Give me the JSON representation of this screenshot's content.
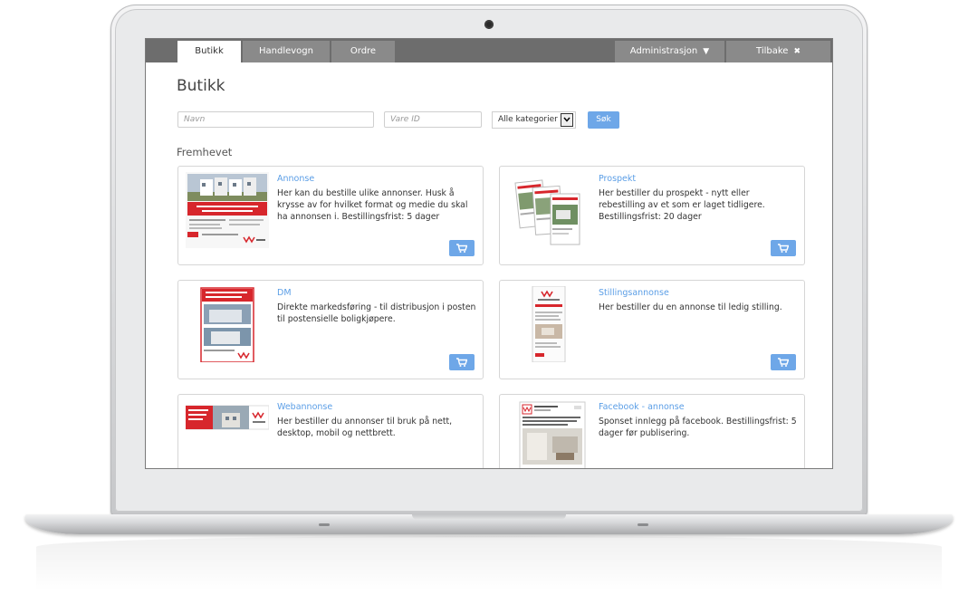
{
  "nav": {
    "tabs": [
      {
        "label": "Butikk"
      },
      {
        "label": "Handlevogn"
      },
      {
        "label": "Ordre"
      }
    ],
    "admin_label": "Administrasjon",
    "back_label": "Tilbake"
  },
  "page": {
    "title": "Butikk",
    "search": {
      "name_placeholder": "Navn",
      "item_id_placeholder": "Vare ID",
      "category_selected": "Alle kategorier",
      "button_label": "Søk"
    },
    "section_title": "Fremhevet"
  },
  "products": [
    {
      "title": "Annonse",
      "description": "Her kan du bestille ulike annonser. Husk å krysse av for hvilket format og medie du skal ha annonsen i. Bestillingsfrist: 5 dager"
    },
    {
      "title": "Prospekt",
      "description": "Her bestiller du prospekt - nytt eller rebestilling av et som er laget tidligere. Bestillingsfrist: 20 dager"
    },
    {
      "title": "DM",
      "description": "Direkte markedsføring - til distribusjon i posten til postensielle boligkjøpere."
    },
    {
      "title": "Stillingsannonse",
      "description": "Her bestiller du en annonse til ledig stilling."
    },
    {
      "title": "Webannonse",
      "description": "Her bestiller du annonser til bruk på nett, desktop, mobil og nettbrett."
    },
    {
      "title": "Facebook - annonse",
      "description": "Sponset innlegg på facebook. Bestillingsfrist: 5 dager før publisering."
    }
  ],
  "colors": {
    "accent": "#6ea7e8",
    "nav_bg": "#6d6d6d",
    "brand_red": "#d7262c"
  },
  "icons": {
    "cart": "shopping-cart-icon",
    "dropdown": "caret-down-icon",
    "close": "close-icon"
  }
}
